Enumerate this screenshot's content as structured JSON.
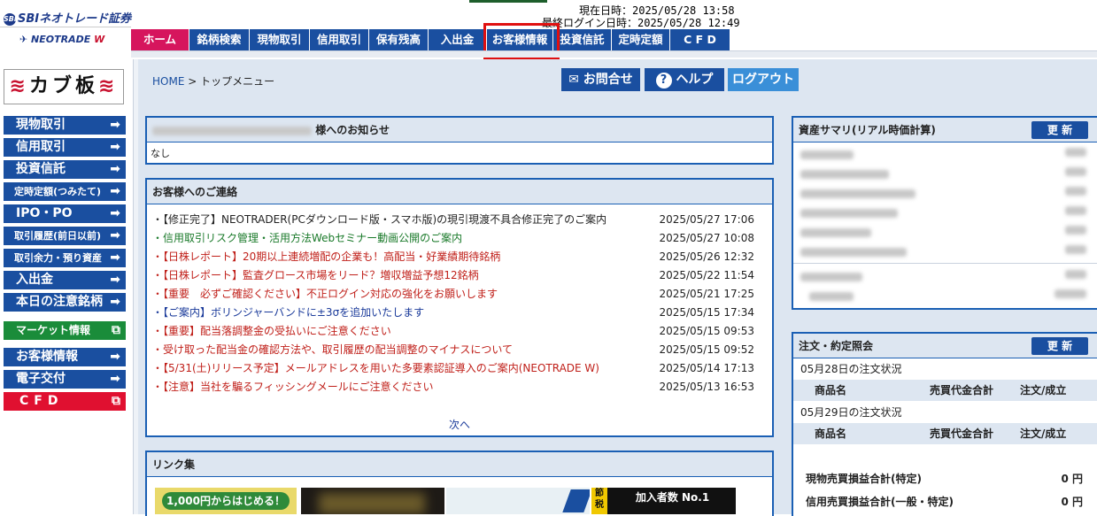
{
  "header": {
    "logo_line1": "SBIネオトレード証券",
    "logo_sbi": "SBI",
    "logo_line2": "NEOTRADE",
    "logo_w": "W",
    "current_datetime_label": "現在日時：2025/05/28 13:58",
    "last_login_label": "最終ログイン日時：2025/05/28 12:49"
  },
  "nav": {
    "items": [
      {
        "label": "ホーム"
      },
      {
        "label": "銘柄検索"
      },
      {
        "label": "現物取引"
      },
      {
        "label": "信用取引"
      },
      {
        "label": "保有残高"
      },
      {
        "label": "入出金"
      },
      {
        "label": "お客様情報"
      },
      {
        "label": "投資信託"
      },
      {
        "label": "定時定額"
      },
      {
        "label": "C F D"
      }
    ],
    "highlighted": "お客様情報"
  },
  "sidebar": {
    "kabuita_text": "カブ板",
    "items": [
      {
        "label": "現物取引"
      },
      {
        "label": "信用取引"
      },
      {
        "label": "投資信託"
      },
      {
        "label": "定時定額(つみたて)"
      },
      {
        "label": "IPO・PO"
      },
      {
        "label": "取引履歴(前日以前)"
      },
      {
        "label": "取引余力・預り資産"
      },
      {
        "label": "入出金"
      },
      {
        "label": "本日の注意銘柄"
      },
      {
        "label": "マーケット情報"
      },
      {
        "label": "お客様情報"
      },
      {
        "label": "電子交付"
      },
      {
        "label": "CFD"
      }
    ]
  },
  "breadcrumb": {
    "home": "HOME",
    "sep": ">",
    "current": "トップメニュー"
  },
  "top_buttons": {
    "contact": "お問合せ",
    "help": "ヘルプ",
    "logout": "ログアウト"
  },
  "notice_panel": {
    "title_suffix": "様へのお知らせ",
    "body": "なし"
  },
  "contact_panel": {
    "title": "お客様へのご連絡",
    "items": [
      {
        "text": "・【修正完了】NEOTRADER(PCダウンロード版・スマホ版)の現引現渡不具合修正完了のご案内",
        "date": "2025/05/27 17:06",
        "color": "black"
      },
      {
        "text": "・信用取引リスク管理・活用方法Webセミナー動画公開のご案内",
        "date": "2025/05/27 10:08",
        "color": "green"
      },
      {
        "text": "・【日株レポート】20期以上連続増配の企業も！高配当・好業績期待銘柄",
        "date": "2025/05/26 12:32",
        "color": "red"
      },
      {
        "text": "・【日株レポート】監査グロース市場をリード？増収増益予想12銘柄",
        "date": "2025/05/22 11:54",
        "color": "red"
      },
      {
        "text": "・【重要　必ずご確認ください】不正ログイン対応の強化をお願いします",
        "date": "2025/05/21 17:25",
        "color": "red"
      },
      {
        "text": "・【ご案内】ボリンジャーバンドに±3σを追加いたします",
        "date": "2025/05/15 17:34",
        "color": "blue"
      },
      {
        "text": "・【重要】配当落調整金の受払いにご注意ください",
        "date": "2025/05/15 09:53",
        "color": "red"
      },
      {
        "text": "・受け取った配当金の確認方法や、取引履歴の配当調整のマイナスについて",
        "date": "2025/05/15 09:52",
        "color": "red"
      },
      {
        "text": "・【5/31(土)リリース予定】メールアドレスを用いた多要素認証導入のご案内(NEOTRADE W)",
        "date": "2025/05/14 17:13",
        "color": "red"
      },
      {
        "text": "・【注意】当社を騙るフィッシングメールにご注意ください",
        "date": "2025/05/13 16:53",
        "color": "red"
      }
    ],
    "next": "次へ"
  },
  "links_panel": {
    "title": "リンク集",
    "banner1": "1,000円からはじめる！",
    "banner4_a": "節",
    "banner4_b": "税",
    "banner4_c": "加入者数 No.1"
  },
  "asset_panel": {
    "title": "資産サマリ(リアル時価計算)",
    "update": "更 新"
  },
  "order_panel": {
    "title": "注文・約定照会",
    "update": "更 新",
    "day1": "05月28日の注文状況",
    "day2": "05月29日の注文状況",
    "col_name": "商品名",
    "col_amount": "売買代金合計",
    "col_status": "注文/成立",
    "pl_spot_label": "現物売買損益合計(特定)",
    "pl_spot_value": "0 円",
    "pl_margin_label": "信用売買損益合計(一般・特定)",
    "pl_margin_value": "0 円"
  },
  "colors": {
    "brand_blue": "#1a4fa0",
    "home_pink": "#d6155d",
    "panel_bg": "#dde6f1",
    "highlight_red": "#e01010"
  }
}
